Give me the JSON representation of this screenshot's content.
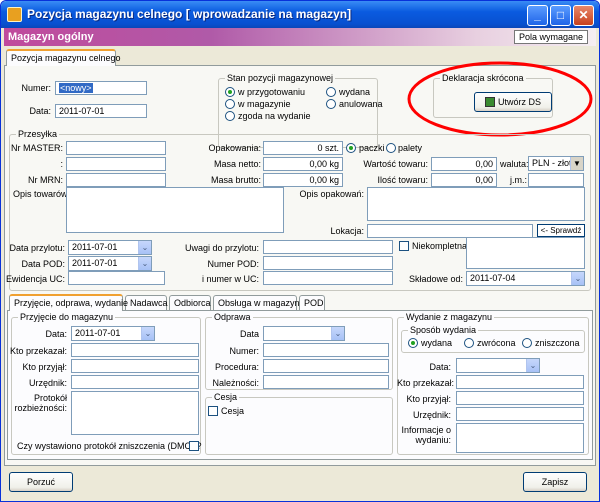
{
  "window": {
    "title": "Pozycja magazynu celnego [ wprowadzanie na magazyn]",
    "min": "_",
    "max": "□",
    "close": "✕"
  },
  "header": {
    "title": "Magazyn ogólny",
    "button": "Pola wymagane"
  },
  "main_tab": "Pozycja magazynu celnego",
  "top": {
    "numer_label": "Numer:",
    "numer_value": "<nowy>",
    "data_label": "Data:",
    "data_value": "2011-07-01"
  },
  "stan": {
    "title": "Stan pozycji magazynowej",
    "options": [
      "w przygotowaniu",
      "w magazynie",
      "zgoda na wydanie",
      "wydana",
      "anulowana"
    ],
    "selected": "w przygotowaniu"
  },
  "deklaracja": {
    "title": "Deklaracja skrócona",
    "button": "Utwórz DS"
  },
  "przesylka": {
    "title": "Przesyłka",
    "nr_master": "Nr MASTER:",
    "colon": ":",
    "nr_mrn": "Nr MRN:",
    "opakowania": "Opakowania:",
    "opakowania_value": "0 szt.",
    "paczki": "paczki",
    "palety": "palety",
    "masa_netto": "Masa netto:",
    "masa_netto_value": "0,00 kg",
    "masa_brutto": "Masa brutto:",
    "masa_brutto_value": "0,00 kg",
    "wartosc": "Wartość towaru:",
    "wartosc_value": "0,00",
    "waluta": "waluta:",
    "waluta_value": "PLN - złoty",
    "ilosc": "Ilość towaru:",
    "ilosc_value": "0,00",
    "jm": "j.m.:",
    "opis_towarow": "Opis towarów:",
    "opis_opakowan": "Opis opakowań:",
    "lokacja": "Lokacja:",
    "sprawdz": "<- Sprawdź",
    "data_przylotu": "Data przylotu:",
    "data_przylotu_value": "2011-07-01",
    "uwagi": "Uwagi do przylotu:",
    "niekompletna": "Niekompletna",
    "data_pod": "Data POD:",
    "data_pod_value": "2011-07-01",
    "numer_pod": "Numer POD:",
    "ewidencja": "Ewidencja UC:",
    "i_numer": "i numer w UC:",
    "skladowe": "Składowe od:",
    "skladowe_value": "2011-07-04"
  },
  "tabs": [
    "Przyjęcie, odprawa, wydanie",
    "Nadawca",
    "Odbiorca",
    "Obsługa w magazynie",
    "POD"
  ],
  "przyjecie": {
    "title": "Przyjęcie do magazynu",
    "data": "Data:",
    "data_value": "2011-07-01",
    "kto_przekazal": "Kto przekazał:",
    "kto_przyjal": "Kto przyjął:",
    "urzednik": "Urzędnik:",
    "protokol": "Protokół rozbieżności:",
    "dmc": "Czy wystawiono protokół zniszczenia (DMC) ?"
  },
  "odprawa": {
    "title": "Odprawa",
    "data": "Data",
    "numer": "Numer:",
    "procedura": "Procedura:",
    "naleznosci": "Należności:"
  },
  "cesja": {
    "title": "Cesja",
    "label": "Cesja"
  },
  "wydanie": {
    "title": "Wydanie z magazynu",
    "sposob": "Sposób wydania",
    "options": [
      "wydana",
      "zwrócona",
      "zniszczona"
    ],
    "selected": "wydana",
    "data": "Data:",
    "kto_przekazal": "Kto przekazał:",
    "kto_przyjal": "Kto przyjął:",
    "urzednik": "Urzędnik:",
    "informacje": "Informacje o wydaniu:"
  },
  "footer": {
    "cancel": "Porzuć",
    "save": "Zapisz"
  },
  "annotation": {
    "color": "#ff0000"
  }
}
